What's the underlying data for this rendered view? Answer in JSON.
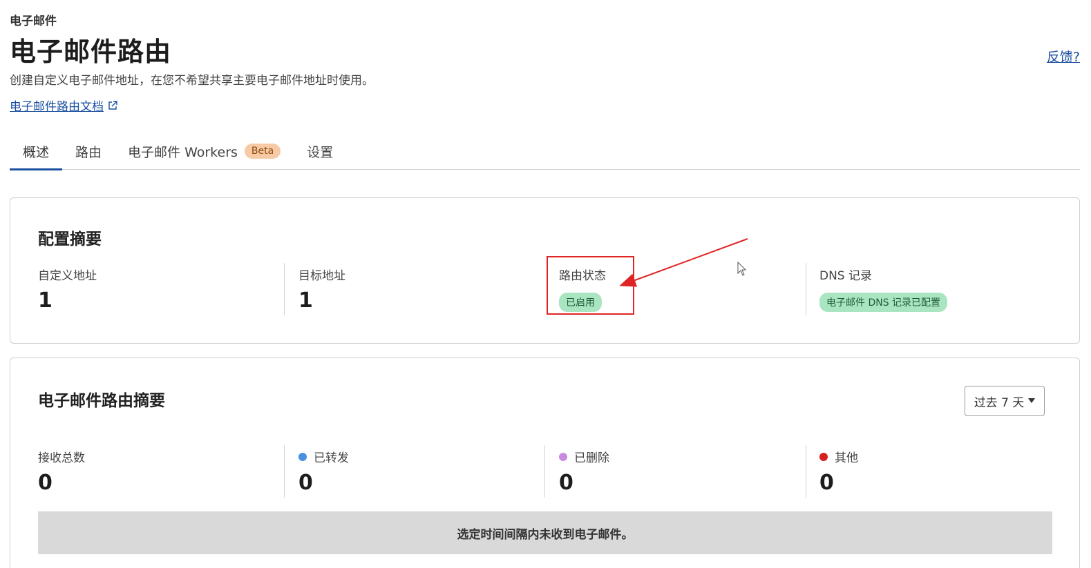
{
  "header": {
    "breadcrumb": "电子邮件",
    "title": "电子邮件路由",
    "description": "创建自定义电子邮件地址，在您不希望共享主要电子邮件地址时使用。",
    "docs_link": "电子邮件路由文档",
    "feedback": "反馈?"
  },
  "tabs": [
    {
      "label": "概述",
      "active": true
    },
    {
      "label": "路由"
    },
    {
      "label": "电子邮件 Workers",
      "badge": "Beta"
    },
    {
      "label": "设置"
    }
  ],
  "config_summary": {
    "title": "配置摘要",
    "custom_address": {
      "label": "自定义地址",
      "value": "1"
    },
    "destination_address": {
      "label": "目标地址",
      "value": "1"
    },
    "routing_status": {
      "label": "路由状态",
      "status": "已启用"
    },
    "dns_records": {
      "label": "DNS 记录",
      "status": "电子邮件 DNS 记录已配置"
    }
  },
  "routing_summary": {
    "title": "电子邮件路由摘要",
    "range": "过去 7 天",
    "total": {
      "label": "接收总数",
      "value": "0"
    },
    "forwarded": {
      "label": "已转发",
      "value": "0",
      "color": "#4a90e2"
    },
    "deleted": {
      "label": "已删除",
      "value": "0",
      "color": "#c98be0"
    },
    "other": {
      "label": "其他",
      "value": "0",
      "color": "#d61f1f"
    },
    "empty_message": "选定时间间隔内未收到电子邮件。"
  },
  "colors": {
    "accent": "#1a4fa0",
    "status_green": "#a8e5c0",
    "annotation_red": "#e02424"
  }
}
